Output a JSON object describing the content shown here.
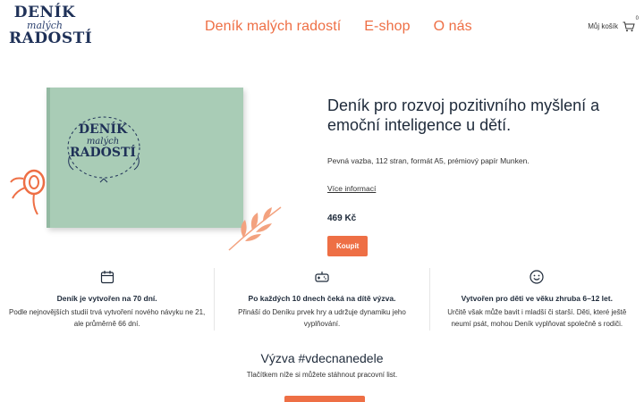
{
  "brand": {
    "line1": "DENÍK",
    "line2": "malých",
    "line3": "RADOSTÍ"
  },
  "nav": [
    {
      "label": "Deník malých radostí"
    },
    {
      "label": "E-shop"
    },
    {
      "label": "O nás"
    }
  ],
  "cart": {
    "label": "Můj košík",
    "count": "0"
  },
  "book_cover": {
    "line1": "DENÍK",
    "line2": "malých",
    "line3": "RADOSTÍ"
  },
  "product": {
    "title": "Deník pro rozvoj pozitivního myšlení a emoční inteligence u dětí.",
    "description": "Pevná vazba, 112 stran, formát A5, prémiový papír Munken.",
    "more_link": "Více informací",
    "price": "469 Kč",
    "buy_label": "Koupit"
  },
  "features": [
    {
      "icon": "calendar-icon",
      "title": "Deník je vytvořen na 70 dní.",
      "text": "Podle nejnovějších studií trvá vytvoření nového návyku ne 21, ale průměrně 66 dní."
    },
    {
      "icon": "gamepad-icon",
      "title": "Po každých 10 dnech čeká na dítě výzva.",
      "text": "Přináší do Deníku prvek hry a udržuje dynamiku jeho vyplňování."
    },
    {
      "icon": "smiley-icon",
      "title": "Vytvořen pro děti ve věku zhruba 6–12 let.",
      "text": "Určitě však může bavit i mladší či starší. Děti, které ještě neumí psát, mohou Deník vyplňovat společně s rodiči."
    }
  ],
  "challenge": {
    "title": "Výzva #vdecnanedele",
    "text": "Tlačítkem níže si můžete stáhnout pracovní list."
  },
  "colors": {
    "accent": "#ee6f45",
    "navy": "#1f3158",
    "book": "#a9ccb6"
  }
}
